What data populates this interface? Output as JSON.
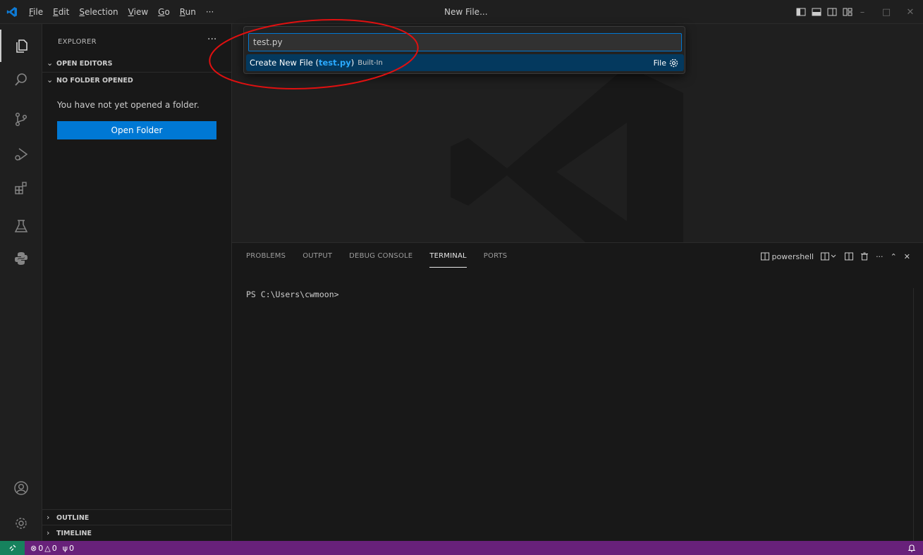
{
  "menu": {
    "items": [
      {
        "pre": "",
        "u": "F",
        "post": "ile"
      },
      {
        "pre": "",
        "u": "E",
        "post": "dit"
      },
      {
        "pre": "",
        "u": "S",
        "post": "election"
      },
      {
        "pre": "",
        "u": "V",
        "post": "iew"
      },
      {
        "pre": "",
        "u": "G",
        "post": "o"
      },
      {
        "pre": "",
        "u": "R",
        "post": "un"
      }
    ],
    "more": "···"
  },
  "window": {
    "title": "New File..."
  },
  "activity_bar": {
    "icons": [
      "files-icon",
      "search-icon",
      "source-control-icon",
      "run-debug-icon",
      "extensions-icon",
      "testing-icon",
      "python-icon",
      "account-icon",
      "manage-gear-icon"
    ]
  },
  "sidebar": {
    "title": "EXPLORER",
    "more": "···",
    "sections": {
      "open_editors": "OPEN EDITORS",
      "no_folder": "NO FOLDER OPENED",
      "outline": "OUTLINE",
      "timeline": "TIMELINE"
    },
    "message": "You have not yet opened a folder.",
    "open_folder_label": "Open Folder"
  },
  "quick_input": {
    "value": "test.py",
    "item": {
      "prefix": "Create New File (",
      "highlight": "test.py",
      "suffix": ")",
      "description": "Built-In",
      "right_label": "File"
    }
  },
  "panel": {
    "tabs": [
      {
        "label": "PROBLEMS",
        "active": false
      },
      {
        "label": "OUTPUT",
        "active": false
      },
      {
        "label": "DEBUG CONSOLE",
        "active": false
      },
      {
        "label": "TERMINAL",
        "active": true
      },
      {
        "label": "PORTS",
        "active": false
      }
    ],
    "terminal_name": "powershell",
    "more": "···",
    "prompt": "PS C:\\Users\\cwmoon>"
  },
  "statusbar": {
    "errors": "0",
    "warnings": "0",
    "ports": "0"
  },
  "colors": {
    "accent": "#0078d4",
    "statusbar": "#68217a",
    "remote": "#16825d",
    "annotation": "#e01010"
  }
}
